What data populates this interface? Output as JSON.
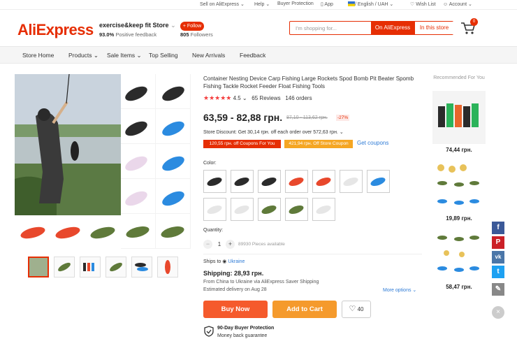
{
  "topbar": {
    "sell": "Sell on AliExpress",
    "help": "Help",
    "buyer_protection": "Buyer Protection",
    "app": "App",
    "locale": "/ English / UAH",
    "wishlist": "Wish List",
    "account": "Account"
  },
  "header": {
    "logo": "AliExpress",
    "store_name": "exercise&keep fit Store",
    "feedback_pct": "93.0%",
    "feedback_label": "Positive feedback",
    "follow": "+ Follow",
    "followers_count": "805",
    "followers_label": "Followers",
    "search_placeholder": "I'm shopping for...",
    "search_ali": "On AliExpress",
    "search_store": "In this store",
    "cart_count": "0"
  },
  "nav": {
    "items": [
      "Store Home",
      "Products",
      "Sale Items",
      "Top Selling",
      "New Arrivals",
      "Feedback"
    ]
  },
  "product": {
    "title": "Container Nesting Device Carp Fishing Large Rockets Spod Bomb Pit Beater Spomb Fishing Tackle Rocket Feeder Float Fishing Tools",
    "stars": "★★★★★",
    "rating": "4.5",
    "reviews": "65 Reviews",
    "orders": "146 orders",
    "price": "63,59 - 82,88 грн.",
    "old_price": "87,10 - 113,62 грн.",
    "discount": "-27%",
    "store_discount": "Store Discount: Get 30,14 грн. off each order over 572,63 грн.",
    "coupon1": "120,55 грн. off Coupons For You",
    "coupon2": "421,94 грн. Off Store Coupon",
    "get_coupons": "Get coupons",
    "color_label": "Color:",
    "quantity_label": "Quantity:",
    "qty_minus": "−",
    "qty_value": "1",
    "qty_plus": "+",
    "qty_available": "89930 Pieces available",
    "ships_to_label": "Ships to",
    "ships_to_country": "Ukraine",
    "shipping": "Shipping: 28,93 грн.",
    "from": "From China to Ukraine via AliExpress Saver Shipping",
    "delivery": "Estimated delivery on Aug 28",
    "more_options": "More options",
    "buy_now": "Buy Now",
    "add_to_cart": "Add to Cart",
    "wish_count": "40",
    "protection_title": "90-Day Buyer Protection",
    "protection_sub": "Money back guarantee"
  },
  "color_options": [
    "black",
    "black",
    "black",
    "red",
    "red",
    "white",
    "blue",
    "white",
    "white",
    "green",
    "green",
    "white"
  ],
  "colors": {
    "black": "#2b2b2b",
    "red": "#e8482c",
    "white": "#e6e6e6",
    "blue": "#2b8be0",
    "green": "#5f7a3a",
    "pink": "#ead7ea",
    "accent": "#e62e04"
  },
  "recommended": {
    "title": "Recommended For You",
    "prices": [
      "74,44 грн.",
      "19,89 грн.",
      "58,47 грн."
    ]
  },
  "social": {
    "facebook": "f",
    "pinterest": "P",
    "vk": "vk",
    "twitter": "t",
    "edit": "✎",
    "close": "×"
  }
}
